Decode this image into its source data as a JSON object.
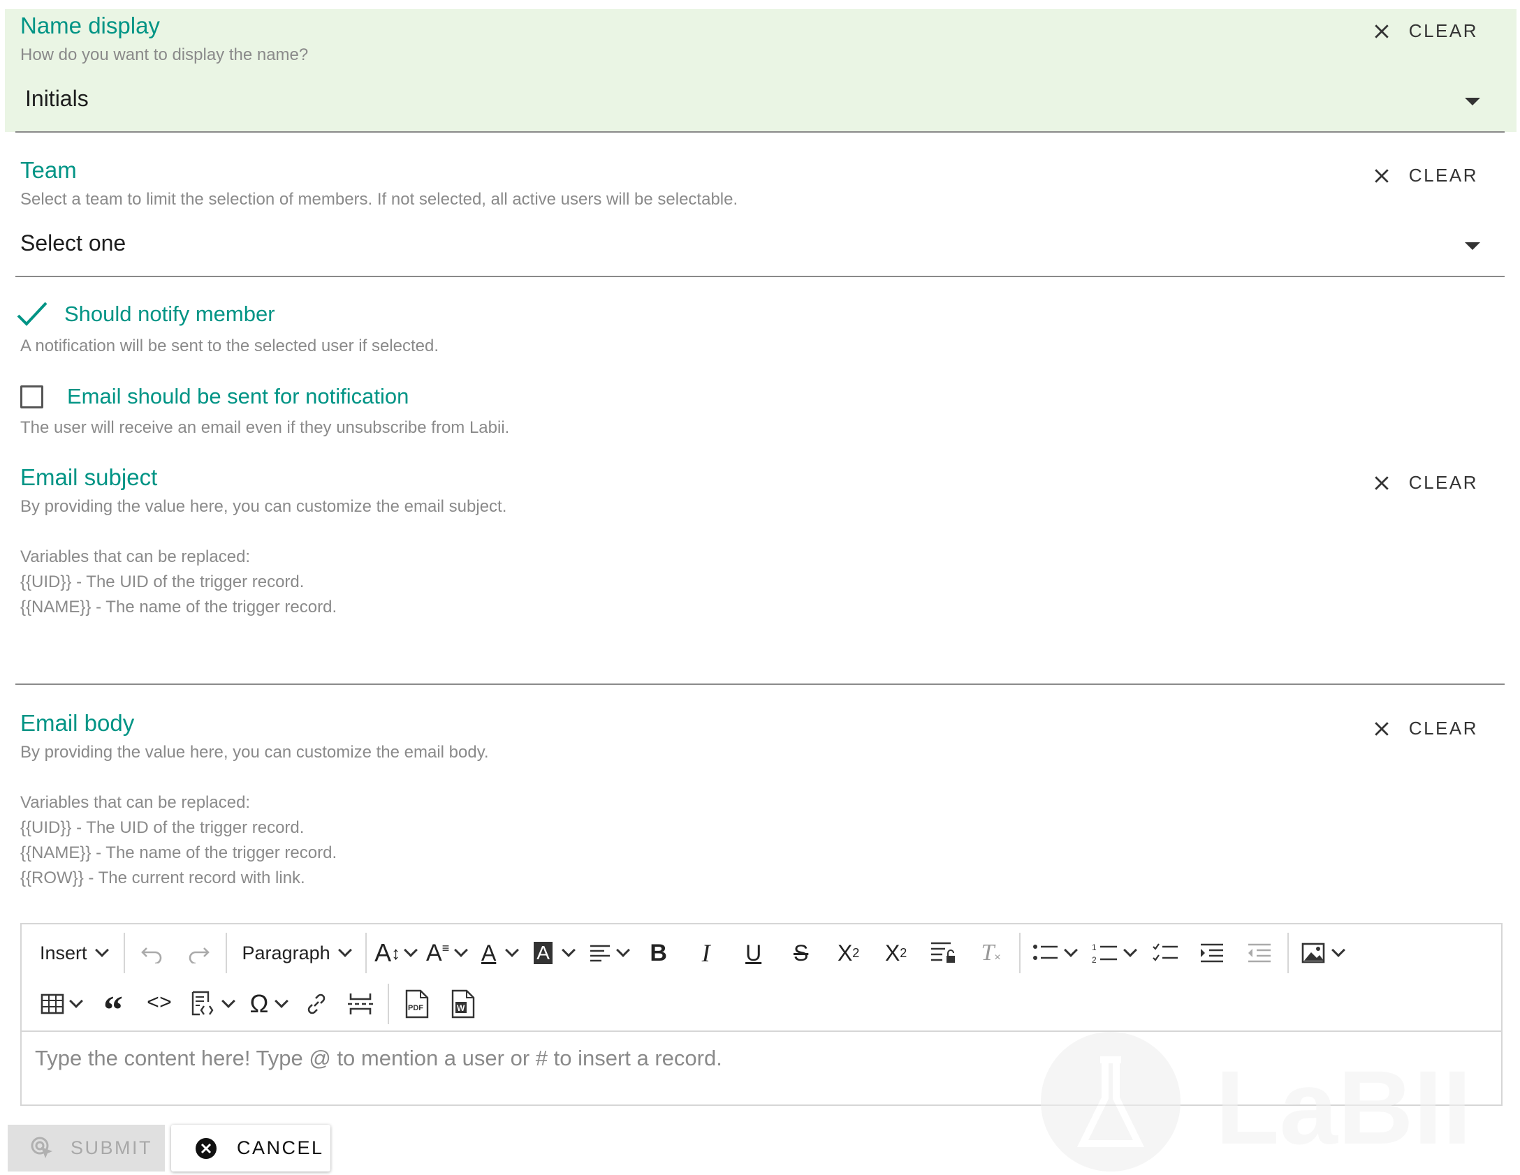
{
  "fields": {
    "name_display": {
      "title": "Name display",
      "description": "How do you want to display the name?",
      "value": "Initials",
      "clear_label": "CLEAR"
    },
    "team": {
      "title": "Team",
      "description": "Select a team to limit the selection of members. If not selected, all active users will be selectable.",
      "value": "Select one",
      "clear_label": "CLEAR"
    },
    "notify_member": {
      "label": "Should notify member",
      "description": "A notification will be sent to the selected user if selected.",
      "checked": true
    },
    "email_notification": {
      "label": "Email should be sent for notification",
      "description": "The user will receive an email even if they unsubscribe from Labii.",
      "checked": false
    },
    "email_subject": {
      "title": "Email subject",
      "description": "By providing the value here, you can customize the email subject.",
      "variables_heading": "Variables that can be replaced:",
      "variables": [
        "{{UID}} - The UID of the trigger record.",
        "{{NAME}} - The name of the trigger record."
      ],
      "clear_label": "CLEAR"
    },
    "email_body": {
      "title": "Email body",
      "description": "By providing the value here, you can customize the email body.",
      "variables_heading": "Variables that can be replaced:",
      "variables": [
        "{{UID}} - The UID of the trigger record.",
        "{{NAME}} - The name of the trigger record.",
        "{{ROW}} - The current record with link."
      ],
      "clear_label": "CLEAR"
    }
  },
  "editor": {
    "insert_label": "Insert",
    "paragraph_label": "Paragraph",
    "placeholder": "Type the content here! Type @ to mention a user or # to insert a record.",
    "icons": [
      "undo-icon",
      "redo-icon",
      "font-size-icon",
      "line-height-icon",
      "font-color-icon",
      "highlight-color-icon",
      "align-icon",
      "bold-icon",
      "italic-icon",
      "underline-icon",
      "strikethrough-icon",
      "subscript-icon",
      "superscript-icon",
      "restricted-editing-icon",
      "remove-format-icon",
      "bulleted-list-icon",
      "numbered-list-icon",
      "todo-list-icon",
      "indent-icon",
      "outdent-icon",
      "image-icon",
      "table-icon",
      "blockquote-icon",
      "code-icon",
      "source-editing-icon",
      "special-characters-icon",
      "link-icon",
      "page-break-icon",
      "export-pdf-icon",
      "export-word-icon"
    ]
  },
  "watermark": {
    "text": "LaBII"
  },
  "actions": {
    "submit_label": "SUBMIT",
    "cancel_label": "CANCEL"
  },
  "colors": {
    "accent": "#009485",
    "active_bg": "#eaf5e4",
    "muted_text": "#8a8a8a"
  }
}
